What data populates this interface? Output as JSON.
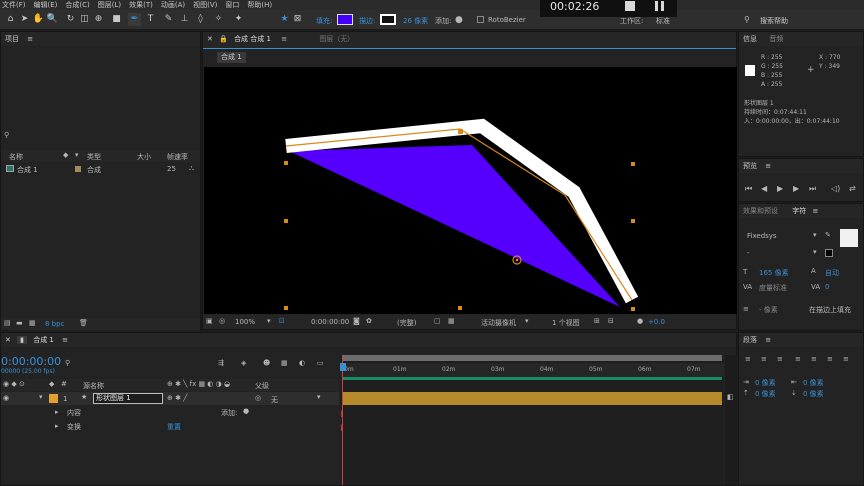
{
  "menu": [
    "文件(F)",
    "编辑(E)",
    "合成(C)",
    "图层(L)",
    "效果(T)",
    "动画(A)",
    "视图(V)",
    "窗口",
    "帮助(H)"
  ],
  "toolbar": {
    "fill_label": "填充:",
    "stroke_label": "描边:",
    "stroke_px": "26 像素",
    "add_label": "添加:",
    "rotobezier": "RotoBezier",
    "workspace": "工作区:",
    "workspace_value": "标准",
    "search_help": "搜索帮助",
    "fill_color": "#4400ff"
  },
  "overlay_timer": "00:02:26",
  "project": {
    "tab": "项目",
    "columns": {
      "name": "名称",
      "type": "类型",
      "size": "大小",
      "fps": "帧速率"
    },
    "item": {
      "name": "合成 1",
      "type": "合成",
      "fps": "25"
    },
    "bpc": "8 bpc"
  },
  "comp_viewer": {
    "tab": "合成 合成 1",
    "layer_tab": "图层（无）",
    "breadcrumb": "合成 1",
    "zoom": "100%",
    "time": "0:00:00:00",
    "resolution": "(完整)",
    "camera": "活动摄像机",
    "views": "1 个视图",
    "exposure": "+0.0",
    "shape_color": "#5500ff"
  },
  "info": {
    "tab": "信息",
    "tab2": "音频",
    "r": "R : 255",
    "g": "G : 255",
    "b": "B : 255",
    "a": "A : 255",
    "x": "X : 770",
    "y": "Y : 349",
    "layer_name": "形状图层 1",
    "duration": "持续时间：0:07:44:11",
    "in_out": "入：0:00:00:00，出：0:07:44:10"
  },
  "preview": {
    "tab": "预览"
  },
  "character": {
    "tab_effects": "效果和预设",
    "tab_char": "字符",
    "font": "Fixedsys",
    "style": "-",
    "size": "165 像素",
    "leading": "自动",
    "kerning": "度量标准",
    "tracking": "0",
    "stroke": "- 像素",
    "stroke_mode": "在描边上填充"
  },
  "paragraph": {
    "tab": "段落",
    "indent_left": "0 像素",
    "indent_right": "0 像素",
    "space_before": "0 像素",
    "space_after": "0 像素"
  },
  "timeline": {
    "tab": "合成 1",
    "timecode": "0:00:00:00",
    "fps_sub": "00000 (25.00 fps)",
    "col_layer_name": "源名称",
    "col_parent": "父级",
    "layer_num": "1",
    "layer_name": "形状图层 1",
    "parent": "无",
    "prop_contents": "内容",
    "prop_add": "添加:",
    "prop_transform": "变换",
    "reset": "重置",
    "ruler": [
      "0m",
      "01m",
      "02m",
      "03m",
      "04m",
      "05m",
      "06m",
      "07m"
    ]
  }
}
